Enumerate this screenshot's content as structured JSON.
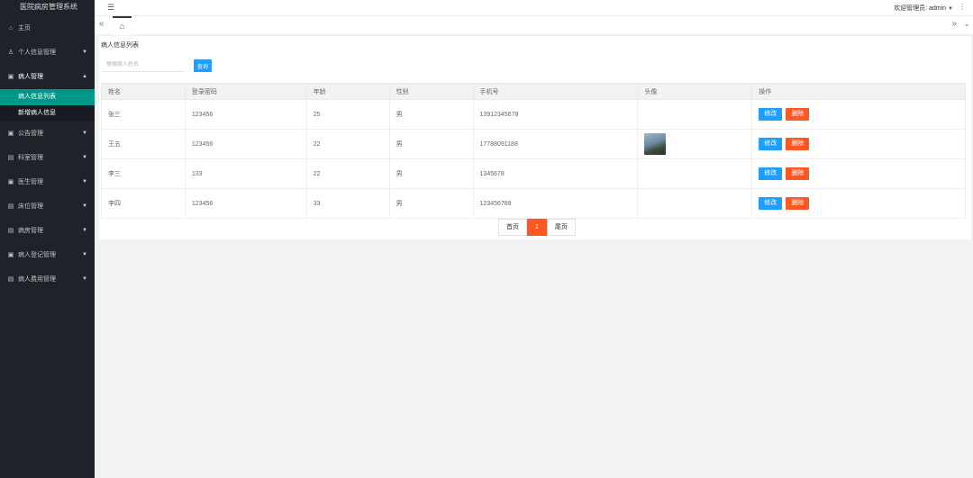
{
  "app": {
    "title": "医院病房管理系统"
  },
  "sidebar": {
    "items": [
      {
        "icon": "home-icon",
        "label": "主页"
      },
      {
        "icon": "user-icon",
        "label": "个人信息管理"
      },
      {
        "icon": "folder-icon",
        "label": "病人管理",
        "open": true,
        "children": [
          {
            "label": "病人信息列表",
            "active": true
          },
          {
            "label": "新增病人信息"
          }
        ]
      },
      {
        "icon": "folder-icon",
        "label": "公告管理"
      },
      {
        "icon": "doc-icon",
        "label": "科室管理"
      },
      {
        "icon": "folder-icon",
        "label": "医生管理"
      },
      {
        "icon": "doc-icon",
        "label": "床位管理"
      },
      {
        "icon": "doc-icon",
        "label": "病房管理"
      },
      {
        "icon": "folder-icon",
        "label": "病人登记管理"
      },
      {
        "icon": "doc-icon",
        "label": "病人费用管理"
      }
    ]
  },
  "header": {
    "welcome": "欢迎管理员: admin"
  },
  "main": {
    "title": "病人信息列表",
    "search": {
      "placeholder": "根据病人姓名",
      "button": "查询"
    },
    "columns": [
      "姓名",
      "登录密码",
      "年龄",
      "性别",
      "手机号",
      "头像",
      "操作"
    ],
    "rows": [
      {
        "name": "张三",
        "password": "123456",
        "age": "25",
        "sex": "男",
        "phone": "13912345678",
        "avatar": false
      },
      {
        "name": "王五",
        "password": "123456",
        "age": "22",
        "sex": "男",
        "phone": "17788091188",
        "avatar": true
      },
      {
        "name": "李三",
        "password": "133",
        "age": "22",
        "sex": "男",
        "phone": "1345678",
        "avatar": false
      },
      {
        "name": "李四",
        "password": "123456",
        "age": "33",
        "sex": "男",
        "phone": "123456789",
        "avatar": false
      }
    ],
    "actions": {
      "edit": "修改",
      "delete": "删除"
    },
    "pager": {
      "first": "首页",
      "current": "1",
      "last": "尾页"
    }
  }
}
